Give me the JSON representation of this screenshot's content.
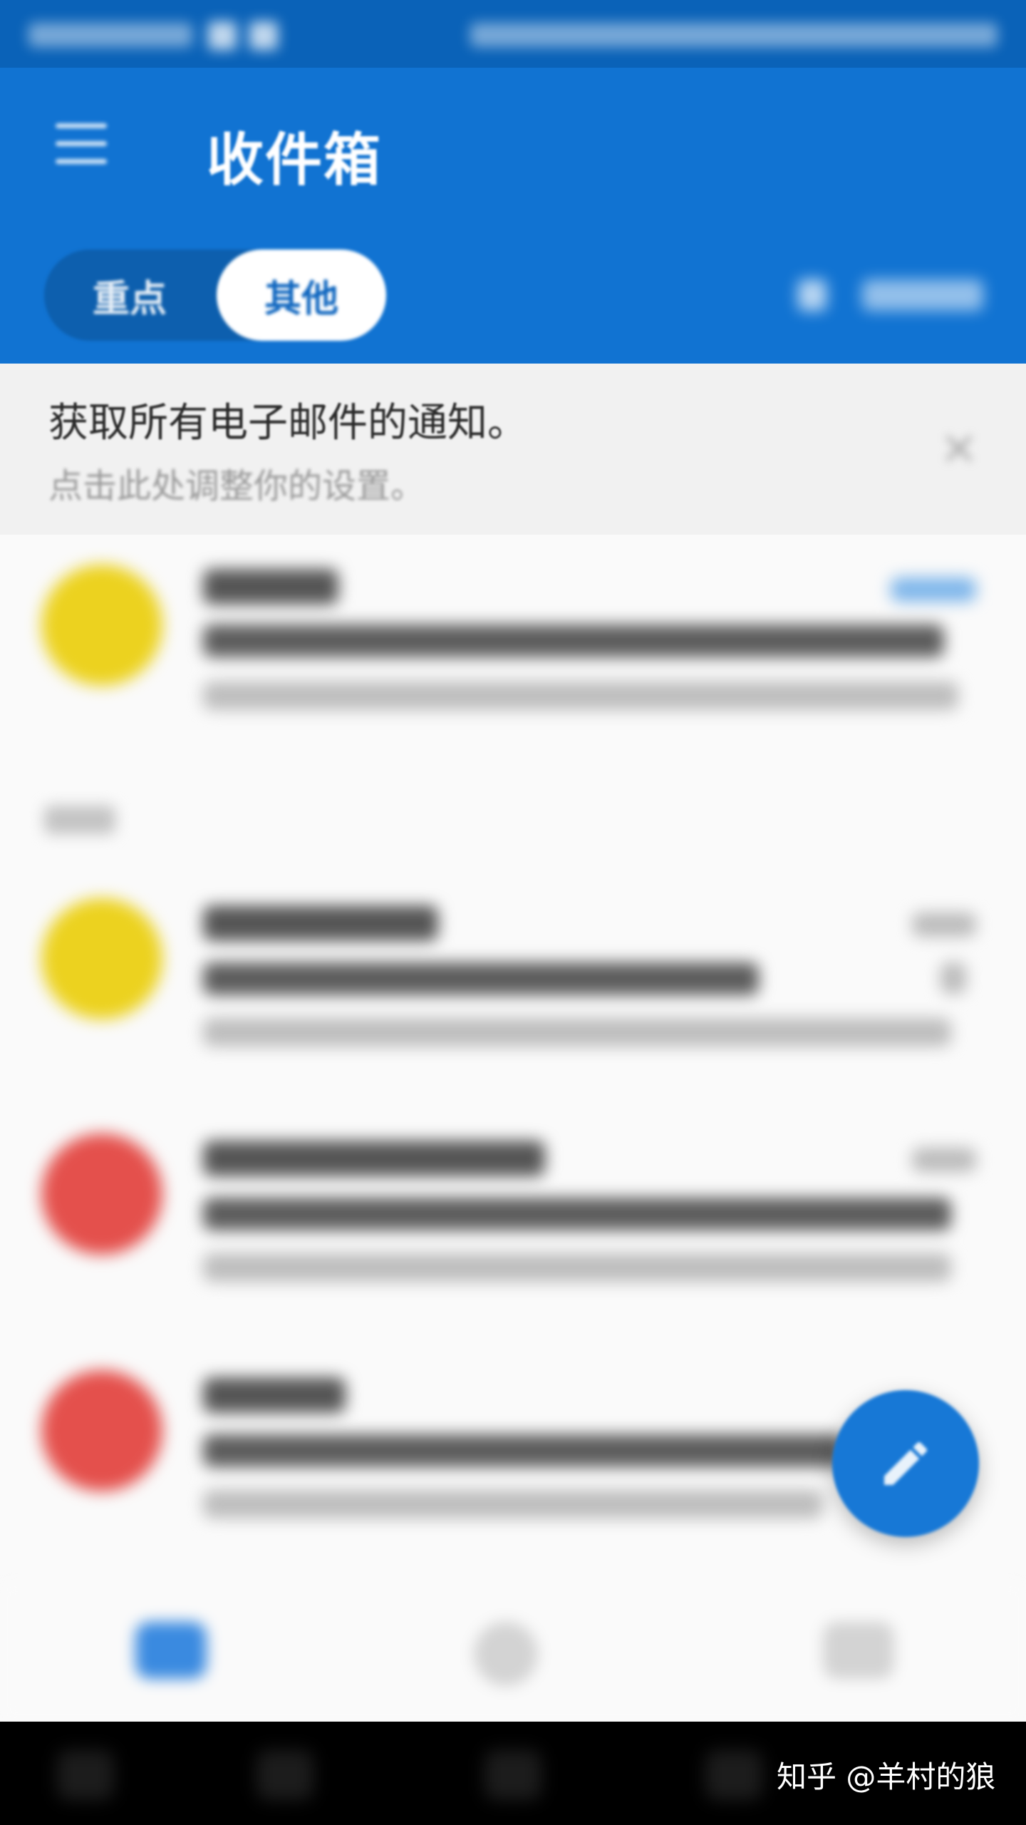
{
  "app": {
    "title": "收件箱",
    "accent_color": "#1173d2"
  },
  "tabs": [
    {
      "label": "重点",
      "selected": false
    },
    {
      "label": "其他",
      "selected": true
    }
  ],
  "notification_banner": {
    "title": "获取所有电子邮件的通知。",
    "subtitle": "点击此处调整你的设置。"
  },
  "icons": {
    "menu": "menu-icon",
    "filter": "filter-icon",
    "close": "close-icon",
    "compose": "pencil-icon",
    "nav_mail": "mail-icon",
    "nav_search": "search-icon",
    "nav_calendar": "calendar-icon"
  },
  "messages": [
    {
      "avatar_color": "#ecd21f"
    },
    {
      "avatar_color": "#ecd21f"
    },
    {
      "avatar_color": "#e4504c"
    },
    {
      "avatar_color": "#e4504c"
    }
  ],
  "watermark": "知乎 @羊村的狼"
}
